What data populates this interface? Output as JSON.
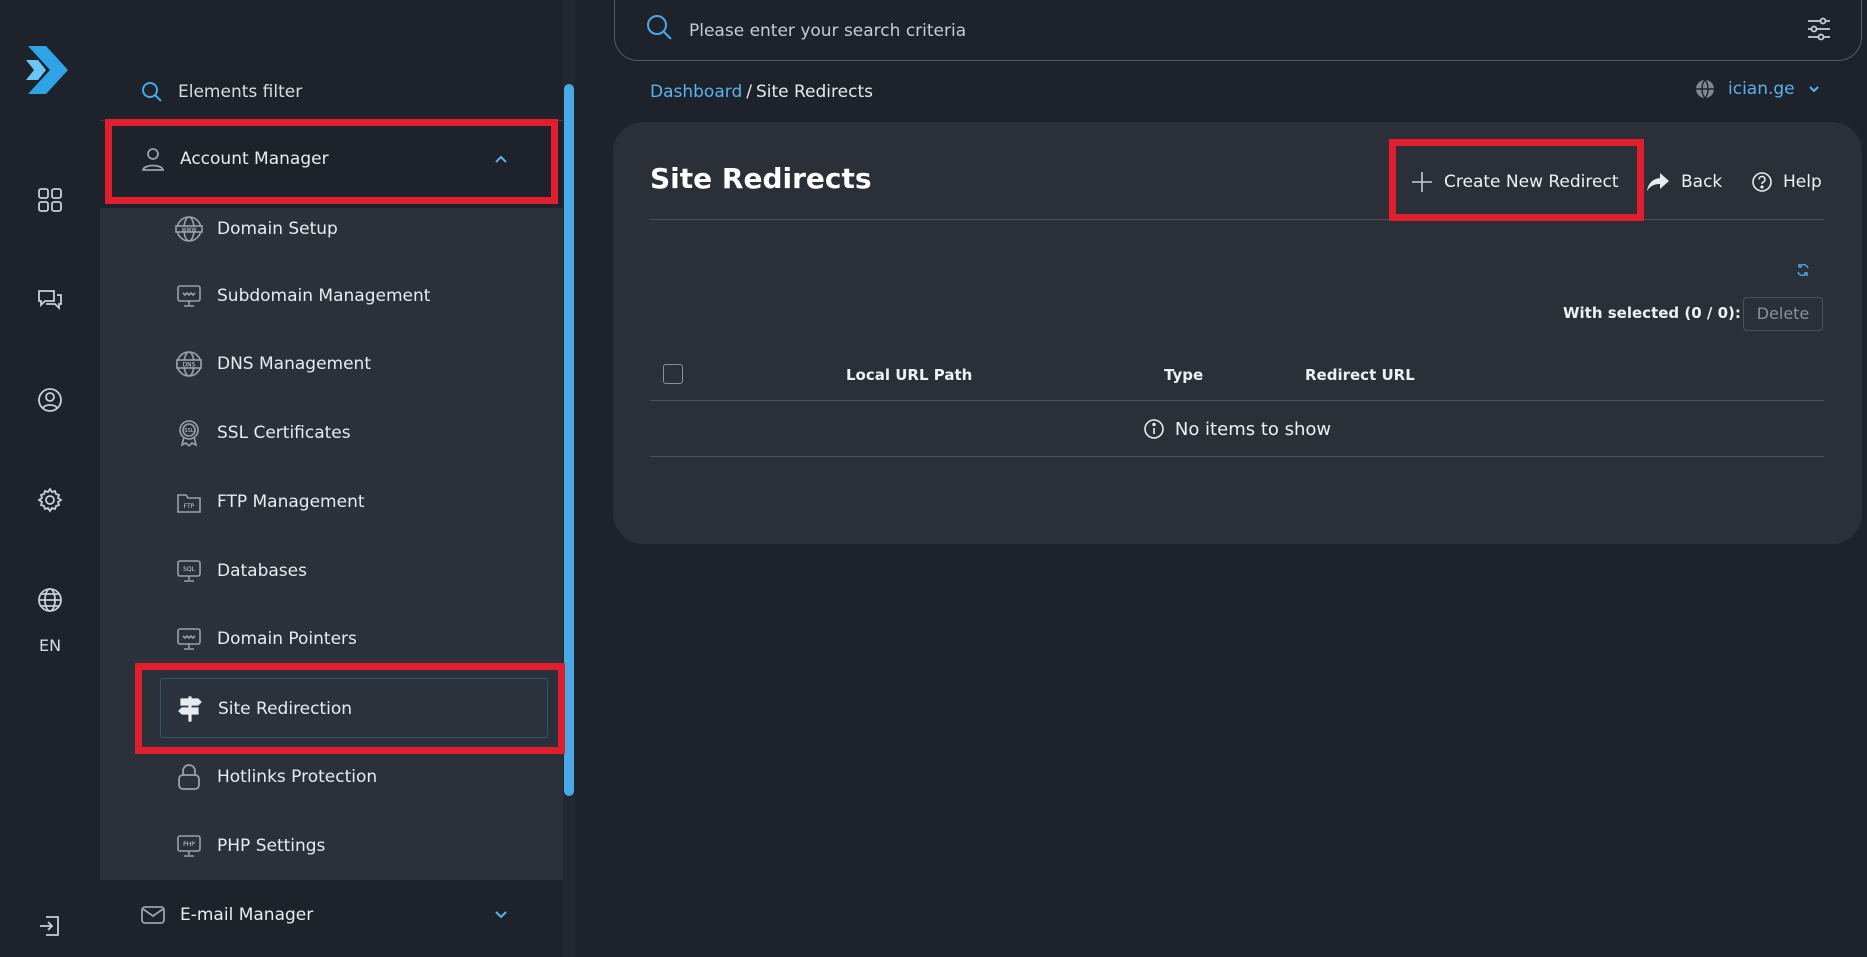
{
  "rail": {
    "language": "EN"
  },
  "sidebar": {
    "filter_label": "Elements filter",
    "account_manager": {
      "label": "Account Manager",
      "items": [
        {
          "label": "Domain Setup",
          "icon": "www-globe-icon"
        },
        {
          "label": "Subdomain Management",
          "icon": "monitor-icon"
        },
        {
          "label": "DNS Management",
          "icon": "dns-globe-icon"
        },
        {
          "label": "SSL Certificates",
          "icon": "ssl-badge-icon"
        },
        {
          "label": "FTP Management",
          "icon": "ftp-folder-icon"
        },
        {
          "label": "Databases",
          "icon": "sql-monitor-icon"
        },
        {
          "label": "Domain Pointers",
          "icon": "monitor-icon"
        },
        {
          "label": "Site Redirection",
          "icon": "signpost-icon"
        },
        {
          "label": "Hotlinks Protection",
          "icon": "lock-icon"
        },
        {
          "label": "PHP Settings",
          "icon": "php-monitor-icon"
        }
      ]
    },
    "email_manager": {
      "label": "E-mail Manager"
    }
  },
  "search": {
    "placeholder": "Please enter your search criteria"
  },
  "breadcrumb": {
    "dashboard": "Dashboard",
    "separator": "/",
    "current": "Site Redirects"
  },
  "domain": {
    "value": "ician.ge"
  },
  "main": {
    "title": "Site Redirects",
    "create_label": "Create New Redirect",
    "back_label": "Back",
    "help_label": "Help",
    "with_selected": "With selected (0 / 0):",
    "delete_label": "Delete",
    "columns": [
      "Local URL Path",
      "Type",
      "Redirect URL"
    ],
    "empty_message": "No items to show"
  },
  "colors": {
    "accent": "#59b2ec",
    "highlight": "#e01e2d",
    "card": "#2a2f38",
    "background": "#1e232b"
  }
}
